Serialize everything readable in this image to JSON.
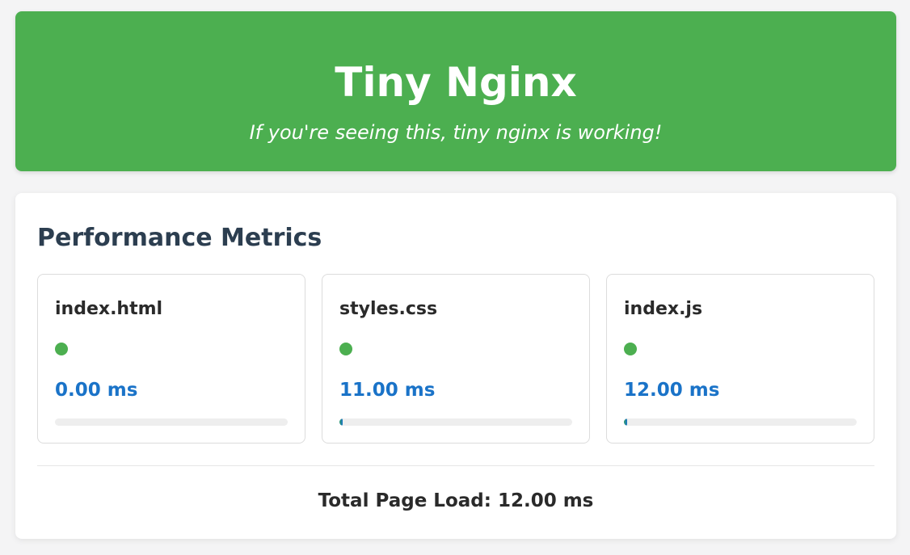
{
  "header": {
    "title": "Tiny Nginx",
    "subtitle": "If you're seeing this, tiny nginx is working!",
    "background_color": "#4caf50"
  },
  "metrics": {
    "heading": "Performance Metrics",
    "cards": [
      {
        "file": "index.html",
        "time": "0.00 ms",
        "status_color": "#4caf50",
        "progress_fraction": 0.0
      },
      {
        "file": "styles.css",
        "time": "11.00 ms",
        "status_color": "#4caf50",
        "progress_fraction": 0.01
      },
      {
        "file": "index.js",
        "time": "12.00 ms",
        "status_color": "#4caf50",
        "progress_fraction": 0.01
      }
    ],
    "total_load": "Total Page Load: 12.00 ms"
  }
}
